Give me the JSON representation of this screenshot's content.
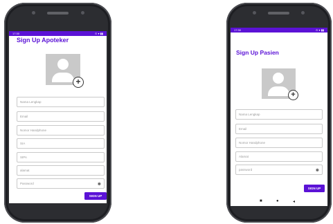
{
  "apoteker": {
    "status_time": "17:30",
    "status_icons": "⊙ ▾ ▮▮",
    "title": "Sign Up Apoteker",
    "fields": [
      {
        "placeholder": "Nama Lengkap"
      },
      {
        "placeholder": "Email"
      },
      {
        "placeholder": "Nomor Handphone"
      },
      {
        "placeholder": "SIA"
      },
      {
        "placeholder": "SIPA"
      },
      {
        "placeholder": "alamat"
      },
      {
        "placeholder": "Password"
      }
    ],
    "signup_label": "SIGN UP",
    "nav": {
      "back": "◂",
      "home": "●",
      "recents": "■"
    }
  },
  "pasien": {
    "status_time": "17:30",
    "status_icons": "⊙ ▾ ▮▮",
    "title": "Sign Up Pasien",
    "fields": [
      {
        "placeholder": "Nama Lengkap"
      },
      {
        "placeholder": "Email"
      },
      {
        "placeholder": "Nomor Handphone"
      },
      {
        "placeholder": "Alamat"
      },
      {
        "placeholder": "password"
      }
    ],
    "signup_label": "SIGN UP",
    "nav": {
      "back": "◂",
      "home": "●",
      "recents": "■"
    }
  },
  "colors": {
    "accent": "#5b12d6",
    "phone_body": "#2c2d31",
    "avatar_bg": "#c9c9c9"
  },
  "icons": {
    "avatar": "person-icon",
    "add_photo": "add-circle-icon",
    "password_toggle": "eye-icon"
  }
}
